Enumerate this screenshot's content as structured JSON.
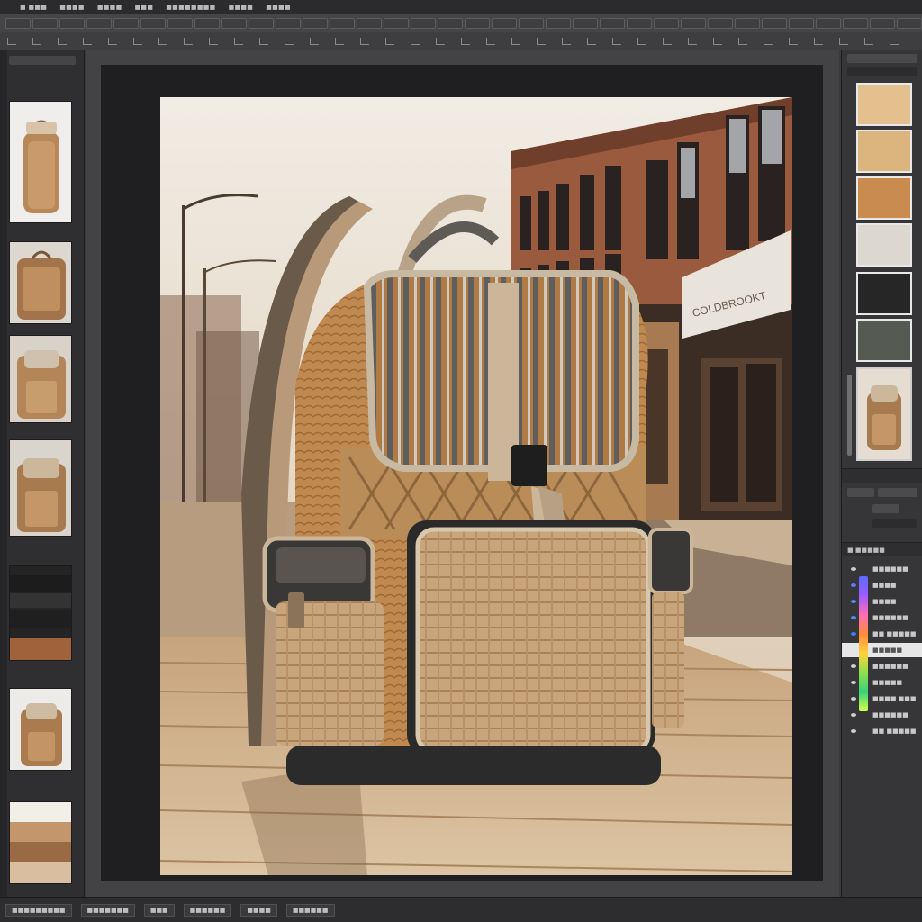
{
  "menubar": {
    "items": [
      "■ ■■■",
      "■■■■",
      "■■■■",
      "■■■",
      "■■■■■■■■",
      "■■■■",
      "■■■■"
    ]
  },
  "layers_panel": {
    "title": "■ ■■■■■",
    "items": [
      {
        "label": "■■■■■■",
        "dot": "#ffffff"
      },
      {
        "label": "■■■■",
        "dot": "#5b7bff"
      },
      {
        "label": "■■■■",
        "dot": "#4a90ff"
      },
      {
        "label": "■■■■■■",
        "dot": "#4a90ff"
      },
      {
        "label": "■■ ■■■■■",
        "dot": "#3b82f6"
      },
      {
        "label": "■■■■■",
        "dot": "#e6e6e6",
        "selected": true
      },
      {
        "label": "■■■■■■",
        "dot": "#ffffff"
      },
      {
        "label": "■■■■■",
        "dot": "#ffffff"
      },
      {
        "label": "■■■■ ■■■",
        "dot": "#ffffff"
      },
      {
        "label": "■■■■■■",
        "dot": "#ffffff"
      },
      {
        "label": "■■ ■■■■■",
        "dot": "#ffffff"
      }
    ]
  },
  "statusbar": {
    "items": [
      "■■■■■■■■■",
      "■■■■■■■",
      "■■■",
      "■■■■■■",
      "■■■■",
      "■■■■■■"
    ]
  },
  "left_footer": "■■■■■■ ■■",
  "storefront_sign": "COLDBROOKT",
  "swatches": {
    "colors": [
      "#e3c08e",
      "#dcb47e",
      "#c98b4e",
      "#ddd8cf",
      "#262626",
      "#555a52"
    ]
  },
  "icons": {
    "layer_visibility": "eye-icon"
  }
}
